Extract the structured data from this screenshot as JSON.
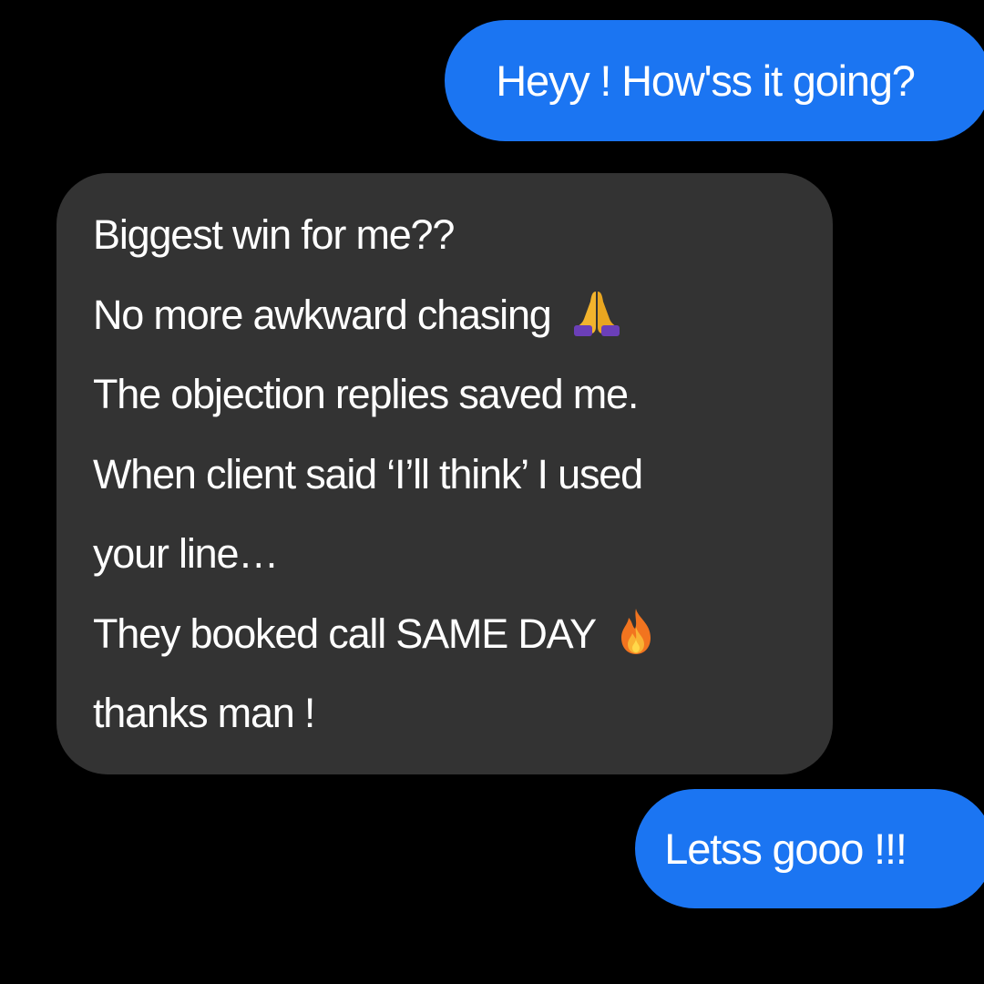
{
  "messages": [
    {
      "direction": "sent",
      "lines": [
        "Heyy ! How'ss it going?"
      ]
    },
    {
      "direction": "received",
      "lines": [
        "Biggest win for me??",
        "No more awkward chasing",
        "The objection replies saved me.",
        "When client said ‘I’ll think’ I used",
        "your line…",
        "They booked call SAME DAY",
        "thanks man !"
      ],
      "emojis": {
        "line_2": "folded-hands-icon",
        "line_6": "fire-icon"
      }
    },
    {
      "direction": "sent",
      "lines": [
        "Letss gooo !!!"
      ]
    }
  ],
  "colors": {
    "background": "#000000",
    "sent_bubble": "#1b75f2",
    "received_bubble": "#333333",
    "text": "#ffffff"
  }
}
